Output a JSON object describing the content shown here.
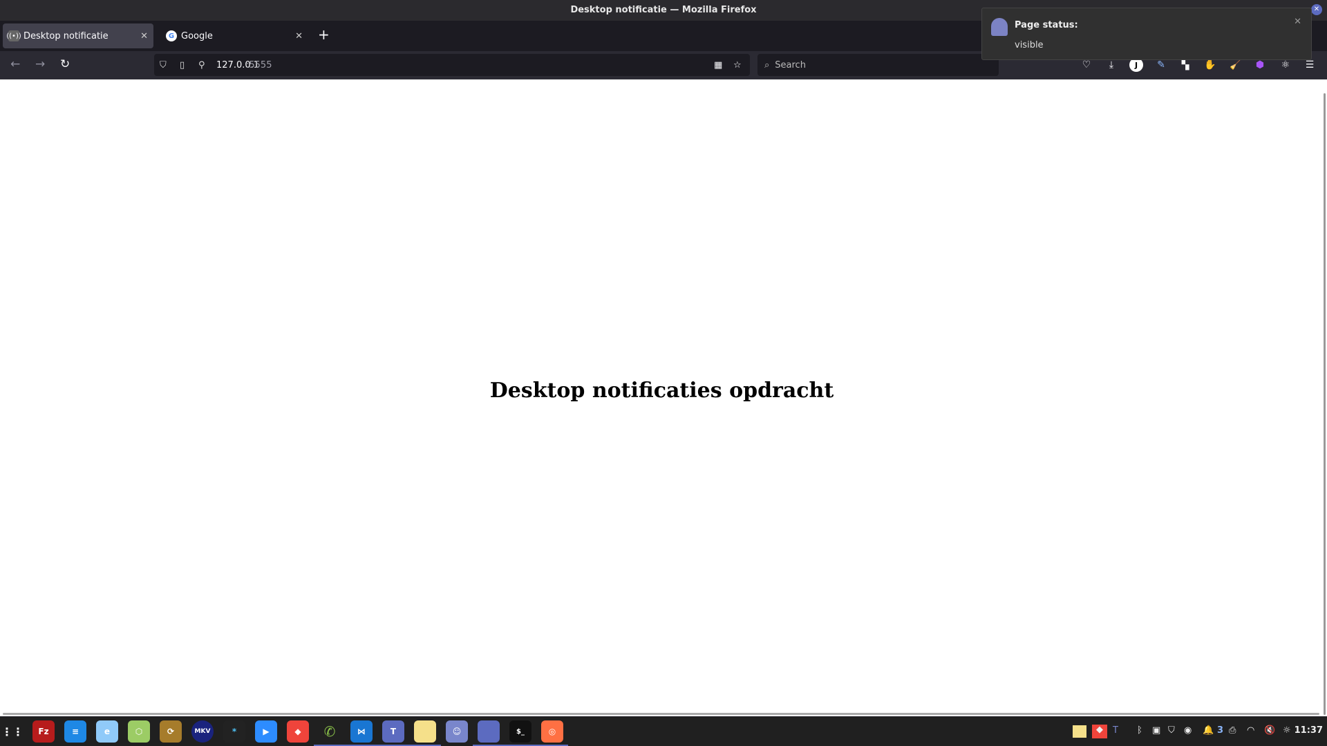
{
  "window": {
    "title": "Desktop notificatie — Mozilla Firefox"
  },
  "tabs": [
    {
      "label": "Desktop notificatie",
      "active": true
    },
    {
      "label": "Google",
      "active": false
    }
  ],
  "urlbar": {
    "host": "127.0.0.1",
    "port": ":5555"
  },
  "search": {
    "placeholder": "Search"
  },
  "page": {
    "heading": "Desktop notificaties opdracht"
  },
  "notification": {
    "title": "Page status:",
    "body": "visible"
  },
  "taskbar": {
    "apps": [
      "FileZilla",
      "Text Editor",
      "Edge",
      "Cube",
      "Sync",
      "MKV",
      "Terminal app",
      "Zoom",
      "AnyDesk",
      "WhatsApp",
      "VS Code",
      "Teams",
      "Sticky Notes",
      "Discord",
      "Files",
      "Terminal",
      "Firefox"
    ],
    "tray_notification_count": "3",
    "clock": "11:37"
  }
}
